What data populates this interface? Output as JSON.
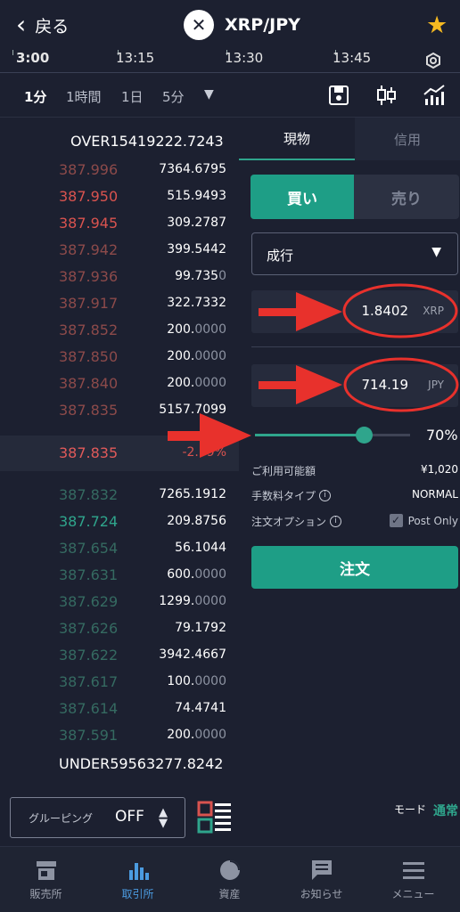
{
  "header": {
    "back_label": "戻る",
    "pair_label": "XRP/JPY",
    "logo_icon": "xrp-logo-icon",
    "favorite_icon": "star-icon"
  },
  "time_axis": [
    "3:00",
    "13:15",
    "13:30",
    "13:45"
  ],
  "intervals": [
    "1分",
    "1時間",
    "1日",
    "5分"
  ],
  "interval_active": "1分",
  "orderbook": {
    "over": "OVER15419222.7243",
    "asks": [
      {
        "price": "387.996",
        "qty_main": "7364.6795",
        "qty_dim": ""
      },
      {
        "price": "387.950",
        "qty_main": "515.9493",
        "qty_dim": ""
      },
      {
        "price": "387.945",
        "qty_main": "309.2787",
        "qty_dim": ""
      },
      {
        "price": "387.942",
        "qty_main": "399.5442",
        "qty_dim": ""
      },
      {
        "price": "387.936",
        "qty_main": "99.735",
        "qty_dim": "0"
      },
      {
        "price": "387.917",
        "qty_main": "322.7332",
        "qty_dim": ""
      },
      {
        "price": "387.852",
        "qty_main": "200.",
        "qty_dim": "0000"
      },
      {
        "price": "387.850",
        "qty_main": "200.",
        "qty_dim": "0000"
      },
      {
        "price": "387.840",
        "qty_main": "200.",
        "qty_dim": "0000"
      },
      {
        "price": "387.835",
        "qty_main": "5157.7099",
        "qty_dim": ""
      }
    ],
    "last_price": "387.835",
    "change_pct": "-2.79%",
    "bids": [
      {
        "price": "387.832",
        "qty_main": "7265.1912",
        "qty_dim": ""
      },
      {
        "price": "387.724",
        "qty_main": "209.8756",
        "qty_dim": ""
      },
      {
        "price": "387.654",
        "qty_main": "56.1044",
        "qty_dim": ""
      },
      {
        "price": "387.631",
        "qty_main": "600.",
        "qty_dim": "0000"
      },
      {
        "price": "387.629",
        "qty_main": "1299.",
        "qty_dim": "0000"
      },
      {
        "price": "387.626",
        "qty_main": "79.1792",
        "qty_dim": ""
      },
      {
        "price": "387.622",
        "qty_main": "3942.4667",
        "qty_dim": ""
      },
      {
        "price": "387.617",
        "qty_main": "100.",
        "qty_dim": "0000"
      },
      {
        "price": "387.614",
        "qty_main": "74.4741",
        "qty_dim": ""
      },
      {
        "price": "387.591",
        "qty_main": "200.",
        "qty_dim": "0000"
      }
    ],
    "under": "UNDER59563277.8242"
  },
  "order_panel": {
    "tab_spot": "現物",
    "tab_margin": "信用",
    "buy_label": "買い",
    "sell_label": "売り",
    "order_type": "成行",
    "amount_value": "1.8402",
    "amount_unit": "XRP",
    "total_value": "714.19",
    "total_unit": "JPY",
    "slider_percent": "70%",
    "slider_fraction": 0.7,
    "available_label": "ご利用可能額",
    "available_value": "¥1,020",
    "fee_label": "手数料タイプ",
    "fee_value": "NORMAL",
    "option_label": "注文オプション",
    "post_only_label": "Post Only",
    "order_button": "注文"
  },
  "bottom_controls": {
    "grouping_label": "グルーピング",
    "grouping_value": "OFF",
    "mode_label": "モード",
    "mode_value": "通常"
  },
  "nav": [
    {
      "label": "販売所",
      "icon": "store-icon"
    },
    {
      "label": "取引所",
      "icon": "bar-chart-icon"
    },
    {
      "label": "資産",
      "icon": "pie-chart-icon"
    },
    {
      "label": "お知らせ",
      "icon": "message-icon"
    },
    {
      "label": "メニュー",
      "icon": "hamburger-icon"
    }
  ],
  "colors": {
    "background": "#1c2030",
    "accent_green": "#1e9e86",
    "ask_red": "#d9534f",
    "bid_green": "#2fa58c",
    "annotation_red": "#e8312c",
    "star_gold": "#f5b921"
  }
}
